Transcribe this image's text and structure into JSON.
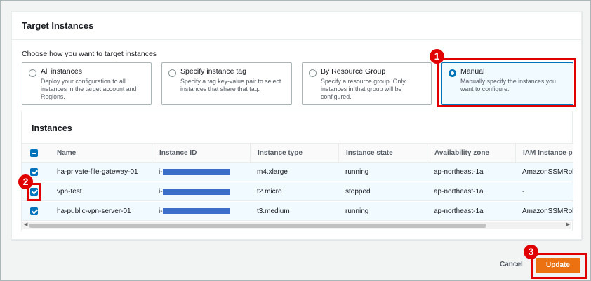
{
  "panel": {
    "title": "Target Instances",
    "choose_label": "Choose how you want to target instances",
    "options": [
      {
        "title": "All instances",
        "desc": "Deploy your configuration to all instances in the target account and Regions.",
        "selected": false
      },
      {
        "title": "Specify instance tag",
        "desc": "Specify a tag key-value pair to select instances that share that tag.",
        "selected": false
      },
      {
        "title": "By Resource Group",
        "desc": "Specify a resource group. Only instances in that group will be configured.",
        "selected": false
      },
      {
        "title": "Manual",
        "desc": "Manually specify the instances you want to configure.",
        "selected": true
      }
    ]
  },
  "instances": {
    "title": "Instances",
    "columns": [
      "Name",
      "Instance ID",
      "Instance type",
      "Instance state",
      "Availability zone",
      "IAM Instance p"
    ],
    "rows": [
      {
        "name": "ha-private-file-gateway-01",
        "id_prefix": "i-",
        "type": "m4.xlarge",
        "state": "running",
        "az": "ap-northeast-1a",
        "iam": "AmazonSSMRol",
        "checked": true
      },
      {
        "name": "vpn-test",
        "id_prefix": "i-",
        "type": "t2.micro",
        "state": "stopped",
        "az": "ap-northeast-1a",
        "iam": "-",
        "checked": true
      },
      {
        "name": "ha-public-vpn-server-01",
        "id_prefix": "i-",
        "type": "t3.medium",
        "state": "running",
        "az": "ap-northeast-1a",
        "iam": "AmazonSSMRol",
        "checked": true
      }
    ]
  },
  "footer": {
    "cancel_label": "Cancel",
    "update_label": "Update"
  },
  "annotations": {
    "step1": "1",
    "step2": "2",
    "step3": "3"
  },
  "colors": {
    "accent": "#0073bb",
    "primary_button": "#ec7211",
    "highlight": "#e10000",
    "redaction": "#3b6ec8"
  }
}
